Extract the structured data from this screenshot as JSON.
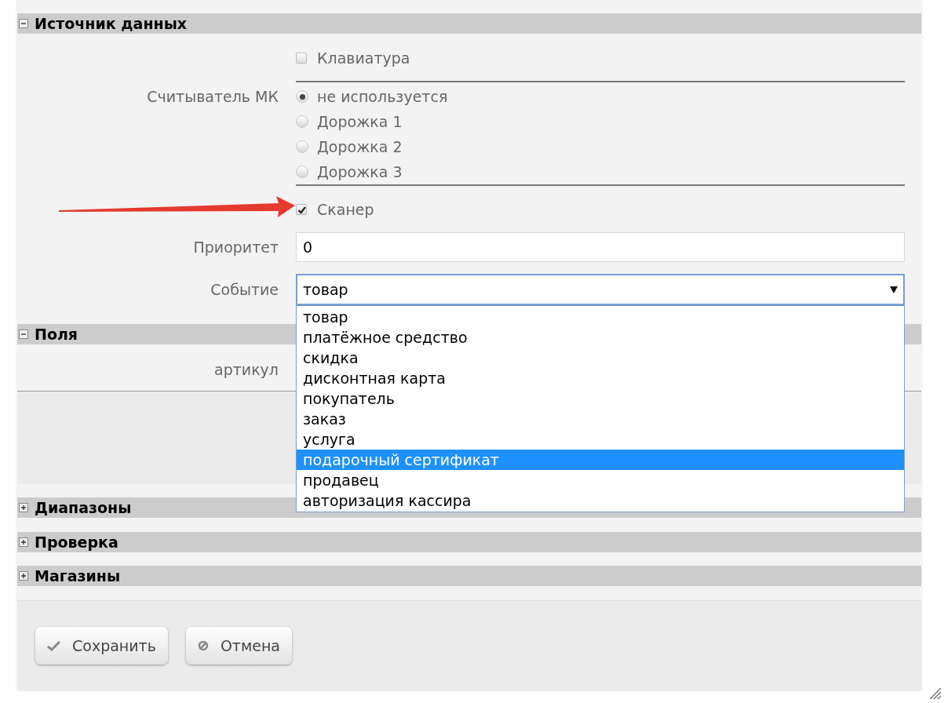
{
  "sections": [
    {
      "title": "Источник данных",
      "expanded": true,
      "fields": [
        {
          "kind": "checkbox",
          "label": "Клавиатура",
          "checked": false
        },
        {
          "kind": "radio_group",
          "label": "Считыватель МК",
          "options": [
            {
              "label": "не используется",
              "selected": true
            },
            {
              "label": "Дорожка 1",
              "selected": false
            },
            {
              "label": "Дорожка 2",
              "selected": false
            },
            {
              "label": "Дорожка 3",
              "selected": false
            }
          ]
        },
        {
          "kind": "checkbox",
          "label": "Сканер",
          "checked": true
        },
        {
          "kind": "input",
          "label": "Приоритет",
          "value": "0"
        },
        {
          "kind": "select",
          "label": "Событие",
          "value": "товар",
          "expanded": true,
          "options": [
            {
              "label": "товар",
              "highlighted": false
            },
            {
              "label": "платёжное средство",
              "highlighted": false
            },
            {
              "label": "скидка",
              "highlighted": false
            },
            {
              "label": "дисконтная карта",
              "highlighted": false
            },
            {
              "label": "покупатель",
              "highlighted": false
            },
            {
              "label": "заказ",
              "highlighted": false
            },
            {
              "label": "услуга",
              "highlighted": false
            },
            {
              "label": "подарочный сертификат",
              "highlighted": true
            },
            {
              "label": "продавец",
              "highlighted": false
            },
            {
              "label": "авторизация кассира",
              "highlighted": false
            }
          ]
        }
      ]
    },
    {
      "title": "Поля",
      "expanded": true,
      "fields": [
        {
          "kind": "label",
          "label": "артикул"
        }
      ]
    },
    {
      "title": "Диапазоны",
      "expanded": false
    },
    {
      "title": "Проверка",
      "expanded": false
    },
    {
      "title": "Магазины",
      "expanded": false
    }
  ],
  "buttons": [
    {
      "label": "Сохранить",
      "kind": "save"
    },
    {
      "label": "Отмена",
      "kind": "cancel"
    }
  ]
}
